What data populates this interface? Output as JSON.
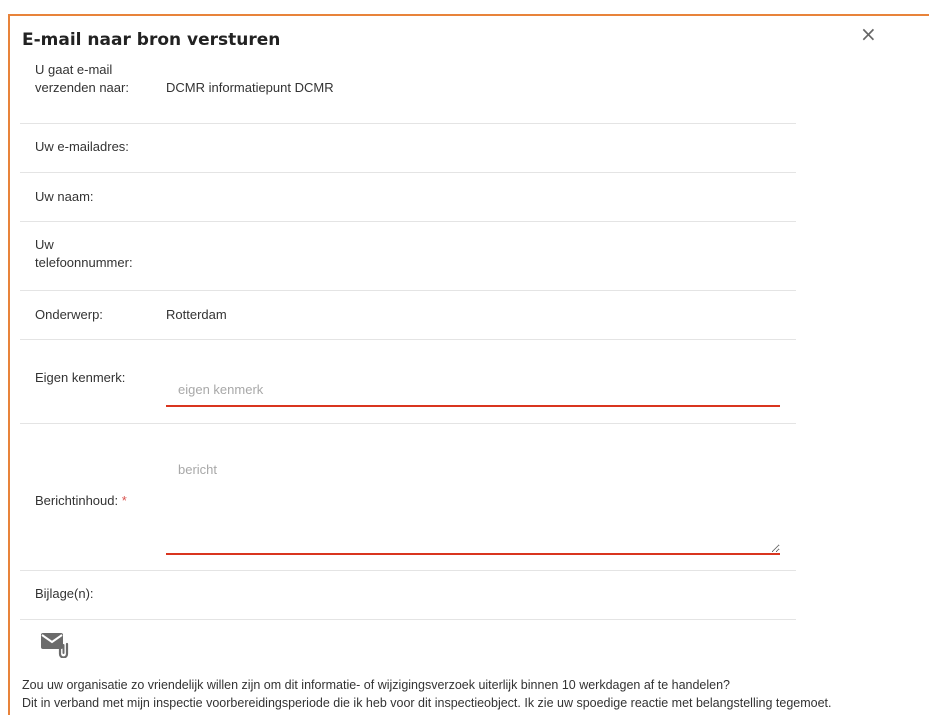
{
  "dialog": {
    "title": "E-mail naar bron versturen",
    "close_glyph": "×"
  },
  "rows": {
    "recipient": {
      "label": "U gaat e-mail verzenden naar:",
      "value": "DCMR informatiepunt DCMR"
    },
    "email": {
      "label": "Uw e-mailadres:",
      "value": ""
    },
    "name": {
      "label": "Uw naam:",
      "value": ""
    },
    "phone": {
      "label": "Uw telefoonnummer:",
      "value": ""
    },
    "subject": {
      "label": "Onderwerp:",
      "value": "Rotterdam"
    },
    "reference": {
      "label": "Eigen kenmerk:",
      "placeholder": "eigen kenmerk",
      "value": ""
    },
    "message": {
      "label": "Berichtinhoud:",
      "required_mark": "*",
      "placeholder": "bericht",
      "value": ""
    },
    "attachments": {
      "label": "Bijlage(n):"
    }
  },
  "icons": {
    "attach": "mail-attachment-icon",
    "close": "close-icon"
  },
  "colors": {
    "accent_border": "#e8833a",
    "input_underline": "#d9351f",
    "required": "#d9534f"
  },
  "footer": {
    "line1": "Zou uw organisatie zo vriendelijk willen zijn om dit informatie- of wijzigingsverzoek uiterlijk binnen 10 werkdagen af te handelen?",
    "line2": "Dit in verband met mijn inspectie voorbereidingsperiode die ik heb voor dit inspectieobject. Ik zie uw spoedige reactie met belangstelling tegemoet."
  }
}
